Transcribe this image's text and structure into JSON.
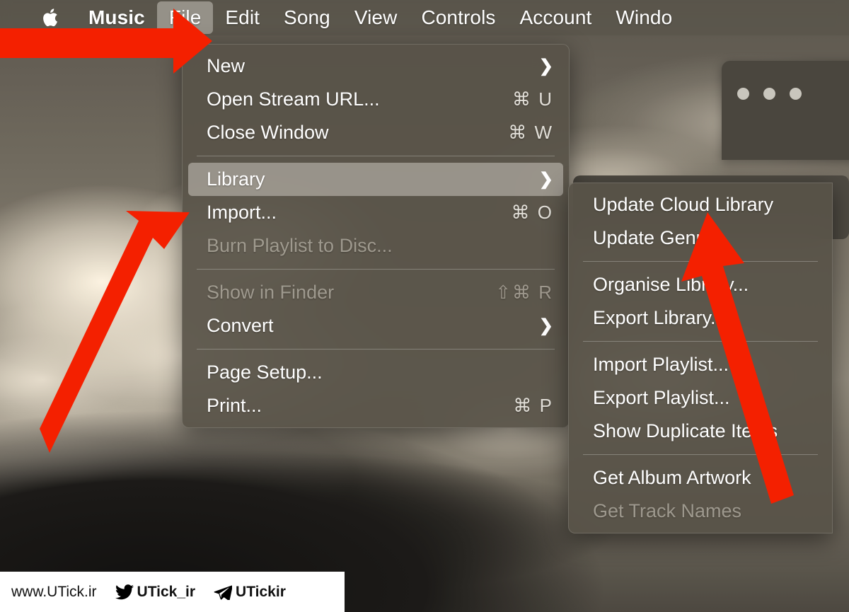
{
  "menubar": {
    "apple_icon": "apple-logo-icon",
    "items": [
      {
        "label": "Music",
        "active": false,
        "bold": true
      },
      {
        "label": "File",
        "active": true,
        "bold": false
      },
      {
        "label": "Edit",
        "active": false,
        "bold": false
      },
      {
        "label": "Song",
        "active": false,
        "bold": false
      },
      {
        "label": "View",
        "active": false,
        "bold": false
      },
      {
        "label": "Controls",
        "active": false,
        "bold": false
      },
      {
        "label": "Account",
        "active": false,
        "bold": false
      },
      {
        "label": "Windo",
        "active": false,
        "bold": false
      }
    ]
  },
  "file_menu": {
    "rows": [
      {
        "type": "item",
        "label": "New",
        "shortcut": "",
        "submenu": true,
        "disabled": false,
        "selected": false
      },
      {
        "type": "item",
        "label": "Open Stream URL...",
        "shortcut": "⌘ U",
        "submenu": false,
        "disabled": false,
        "selected": false
      },
      {
        "type": "item",
        "label": "Close Window",
        "shortcut": "⌘ W",
        "submenu": false,
        "disabled": false,
        "selected": false
      },
      {
        "type": "separator"
      },
      {
        "type": "item",
        "label": "Library",
        "shortcut": "",
        "submenu": true,
        "disabled": false,
        "selected": true
      },
      {
        "type": "item",
        "label": "Import...",
        "shortcut": "⌘ O",
        "submenu": false,
        "disabled": false,
        "selected": false
      },
      {
        "type": "item",
        "label": "Burn Playlist to Disc...",
        "shortcut": "",
        "submenu": false,
        "disabled": true,
        "selected": false
      },
      {
        "type": "separator"
      },
      {
        "type": "item",
        "label": "Show in Finder",
        "shortcut": "⇧⌘ R",
        "submenu": false,
        "disabled": true,
        "selected": false
      },
      {
        "type": "item",
        "label": "Convert",
        "shortcut": "",
        "submenu": true,
        "disabled": false,
        "selected": false
      },
      {
        "type": "separator"
      },
      {
        "type": "item",
        "label": "Page Setup...",
        "shortcut": "",
        "submenu": false,
        "disabled": false,
        "selected": false
      },
      {
        "type": "item",
        "label": "Print...",
        "shortcut": "⌘ P",
        "submenu": false,
        "disabled": false,
        "selected": false
      }
    ]
  },
  "library_submenu": {
    "rows": [
      {
        "type": "item",
        "label": "Update Cloud Library",
        "disabled": false
      },
      {
        "type": "item",
        "label": "Update Genres",
        "disabled": false
      },
      {
        "type": "separator"
      },
      {
        "type": "item",
        "label": "Organise Library...",
        "disabled": false
      },
      {
        "type": "item",
        "label": "Export Library...",
        "disabled": false
      },
      {
        "type": "separator"
      },
      {
        "type": "item",
        "label": "Import Playlist...",
        "disabled": false
      },
      {
        "type": "item",
        "label": "Export Playlist...",
        "disabled": false
      },
      {
        "type": "item",
        "label": "Show Duplicate Items",
        "disabled": false
      },
      {
        "type": "separator"
      },
      {
        "type": "item",
        "label": "Get Album Artwork",
        "disabled": false
      },
      {
        "type": "item",
        "label": "Get Track Names",
        "disabled": true
      }
    ]
  },
  "annotations": {
    "arrow_color": "#f42000",
    "arrows": [
      {
        "name": "arrow-to-file-menu",
        "points_at": "File"
      },
      {
        "name": "arrow-to-library-item",
        "points_at": "Library"
      },
      {
        "name": "arrow-to-update-cloud-library",
        "points_at": "Update Cloud Library"
      }
    ]
  },
  "watermark": {
    "site": "www.UTick.ir",
    "twitter_icon": "twitter-bird-icon",
    "twitter_handle": "UTick_ir",
    "telegram_icon": "telegram-plane-icon",
    "telegram_handle": "UTickir"
  }
}
